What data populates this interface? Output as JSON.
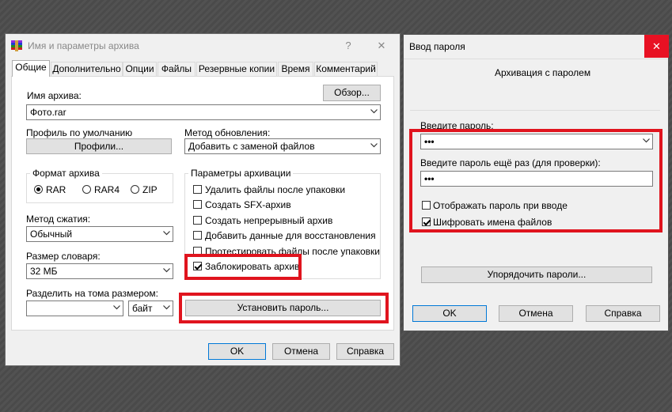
{
  "left_window": {
    "title": "Имя и параметры архива",
    "help_button": "?",
    "close_button": "✕",
    "tabs": [
      "Общие",
      "Дополнительно",
      "Опции",
      "Файлы",
      "Резервные копии",
      "Время",
      "Комментарий"
    ],
    "archive_name_label": "Имя архива:",
    "browse_button": "Обзор...",
    "archive_name_value": "Фото.rar",
    "profile_label": "Профиль по умолчанию",
    "profiles_button": "Профили...",
    "update_method_label": "Метод обновления:",
    "update_method_value": "Добавить с заменой файлов",
    "format_group_title": "Формат архива",
    "formats": [
      "RAR",
      "RAR4",
      "ZIP"
    ],
    "selected_format": "RAR",
    "compression_label": "Метод сжатия:",
    "compression_value": "Обычный",
    "dictionary_label": "Размер словаря:",
    "dictionary_value": "32 МБ",
    "split_label": "Разделить на тома размером:",
    "split_value": "",
    "split_unit": "байт",
    "params_group_title": "Параметры архивации",
    "options": [
      {
        "label": "Удалить файлы после упаковки",
        "checked": false
      },
      {
        "label": "Создать SFX-архив",
        "checked": false
      },
      {
        "label": "Создать непрерывный архив",
        "checked": false
      },
      {
        "label": "Добавить данные для восстановления",
        "checked": false
      },
      {
        "label": "Протестировать файлы после упаковки",
        "checked": false
      },
      {
        "label": "Заблокировать архив",
        "checked": true
      }
    ],
    "set_password_button": "Установить пароль...",
    "ok_button": "OK",
    "cancel_button": "Отмена",
    "help_text_button": "Справка"
  },
  "right_window": {
    "title": "Ввод пароля",
    "close_button": "✕",
    "heading": "Архивация с паролем",
    "password_label": "Введите пароль:",
    "password_value": "•••",
    "password_repeat_label": "Введите пароль ещё раз (для проверки):",
    "password_repeat_value": "•••",
    "show_password_label": "Отображать пароль при вводе",
    "show_password_checked": false,
    "encrypt_names_label": "Шифровать имена файлов",
    "encrypt_names_checked": true,
    "organize_button": "Упорядочить пароли...",
    "ok_button": "OK",
    "cancel_button": "Отмена",
    "help_text_button": "Справка"
  },
  "colors": {
    "highlight": "#e0141e",
    "right_titlebar": "#f0f0f0",
    "close_button_bg": "#e81123"
  }
}
